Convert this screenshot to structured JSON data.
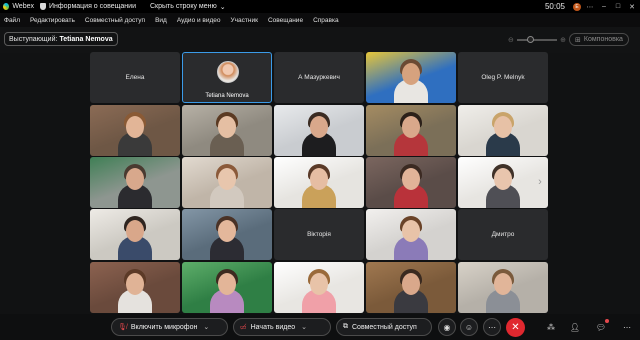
{
  "titlebar": {
    "app_name": "Webex",
    "info_label": "Информация о совещании",
    "hide_menu_label": "Скрыть строку меню",
    "time": "50:05",
    "badge": "E"
  },
  "menu": {
    "items": [
      "Файл",
      "Редактировать",
      "Совместный доступ",
      "Вид",
      "Аудио и видео",
      "Участник",
      "Совещание",
      "Справка"
    ]
  },
  "presenter": {
    "label": "Выступающий:",
    "name": "Tetiana Nemova"
  },
  "layout_button": {
    "label": "Компоновка"
  },
  "tiles": [
    {
      "type": "name",
      "name": "Елена"
    },
    {
      "type": "avatar",
      "name": "Tetiana Nemova",
      "active": true
    },
    {
      "type": "name",
      "name": "А Мазуркевич"
    },
    {
      "type": "video",
      "bg": "#2f6fc0",
      "accent": "#e7c63a",
      "skin": "#d6a27e",
      "hair": "#6b4a33",
      "shirt": "#e8e6e2"
    },
    {
      "type": "name",
      "name": "Oleg P. Melnyk"
    },
    {
      "type": "video",
      "bg": "#6e5745",
      "accent": "#8b6b55",
      "skin": "#e2b597",
      "hair": "#8a5a35",
      "shirt": "#3a3a3a"
    },
    {
      "type": "video",
      "bg": "#8f8a80",
      "accent": "#b7b1a6",
      "skin": "#e5bfa3",
      "hair": "#5b3a22",
      "shirt": "#6a5f52"
    },
    {
      "type": "video",
      "bg": "#c9ccd0",
      "accent": "#e8eaec",
      "skin": "#d9a88b",
      "hair": "#3a2b22",
      "shirt": "#1d1d1f"
    },
    {
      "type": "video",
      "bg": "#7b6f58",
      "accent": "#a58c62",
      "skin": "#d9a88b",
      "hair": "#2b2019",
      "shirt": "#b5363b"
    },
    {
      "type": "video",
      "bg": "#d9d6d0",
      "accent": "#f0eeea",
      "skin": "#e7c1a6",
      "hair": "#c9a46a",
      "shirt": "#2a3a4a"
    },
    {
      "type": "video",
      "bg": "#8e9690",
      "accent": "#3f7f55",
      "skin": "#d8a88c",
      "hair": "#4a3a30",
      "shirt": "#2b2b2f"
    },
    {
      "type": "video",
      "bg": "#c0b5a8",
      "accent": "#e2dad0",
      "skin": "#e8c6ad",
      "hair": "#8b5a3a",
      "shirt": "#d2c9bf"
    },
    {
      "type": "video",
      "bg": "#e6e4e0",
      "accent": "#ffffff",
      "skin": "#e6bda3",
      "hair": "#5a3a28",
      "shirt": "#caa15a"
    },
    {
      "type": "video",
      "bg": "#5a4c48",
      "accent": "#7b665f",
      "skin": "#e1b398",
      "hair": "#3b2a22",
      "shirt": "#b9323a"
    },
    {
      "type": "video",
      "bg": "#e7e5e1",
      "accent": "#ffffff",
      "skin": "#e8c5ad",
      "hair": "#3f3128",
      "shirt": "#4f4f55"
    },
    {
      "type": "video",
      "bg": "#ccc9c2",
      "accent": "#eeebe6",
      "skin": "#d9a78a",
      "hair": "#2f2520",
      "shirt": "#3a4b6a"
    },
    {
      "type": "video",
      "bg": "#5a6c7b",
      "accent": "#8396a6",
      "skin": "#e3b79b",
      "hair": "#4a3226",
      "shirt": "#2c2c33"
    },
    {
      "type": "name",
      "name": "Вікторія"
    },
    {
      "type": "video",
      "bg": "#d4d2cf",
      "accent": "#f2f0ee",
      "skin": "#e8c3a8",
      "hair": "#6a4328",
      "shirt": "#8b7bb8"
    },
    {
      "type": "name",
      "name": "Дмитро"
    },
    {
      "type": "video",
      "bg": "#6a4a3c",
      "accent": "#8c6250",
      "skin": "#e0b396",
      "hair": "#5c3a27",
      "shirt": "#e5e2de"
    },
    {
      "type": "video",
      "bg": "#2f7f45",
      "accent": "#5eae6a",
      "skin": "#e3b598",
      "hair": "#3d2a20",
      "shirt": "#b88ac0"
    },
    {
      "type": "video",
      "bg": "#e8e6e2",
      "accent": "#ffffff",
      "skin": "#e8c3a8",
      "hair": "#9a6a3a",
      "shirt": "#f0a0a8"
    },
    {
      "type": "video",
      "bg": "#7b5a3a",
      "accent": "#a07850",
      "skin": "#d9a88b",
      "hair": "#3a2a20",
      "shirt": "#3a3a40"
    },
    {
      "type": "video",
      "bg": "#b5b0a8",
      "accent": "#d8d2c8",
      "skin": "#e1b599",
      "hair": "#7a5a3c",
      "shirt": "#8b8f96"
    }
  ],
  "controls": {
    "mic_label": "Включить микрофон",
    "video_label": "Начать видео",
    "share_label": "Совместный доступ"
  }
}
